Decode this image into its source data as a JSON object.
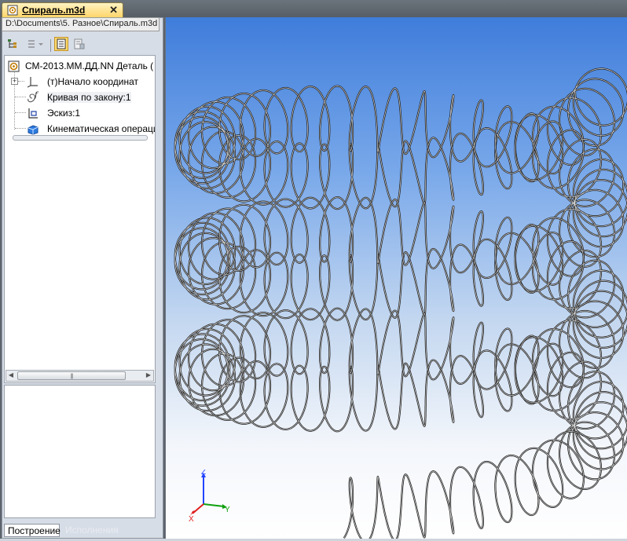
{
  "document_tab": {
    "title": "Спираль.m3d",
    "close_glyph": "✕",
    "icon": "part-document-icon"
  },
  "path_tooltip": "D:\\Documents\\5. Разное\\Спираль.m3d",
  "toolbar": {
    "buttons": [
      {
        "icon": "tree-structure-icon"
      },
      {
        "icon": "filter-dropdown-icon"
      },
      {
        "icon": "build-tree-icon",
        "active": true
      },
      {
        "icon": "properties-page-icon"
      }
    ]
  },
  "tree": {
    "items": [
      {
        "label": "СМ-2013.ММ.ДД.NN Деталь (",
        "icon": "part-icon"
      },
      {
        "label": "(т)Начало координат",
        "icon": "origin-icon",
        "expander": "+"
      },
      {
        "label": "Кривая по закону:1",
        "icon": "formula-curve-icon",
        "icon_glyph": "f"
      },
      {
        "label": "Эскиз:1",
        "icon": "sketch-icon"
      },
      {
        "label": "Кинематическая операци",
        "icon": "sweep-operation-icon"
      }
    ]
  },
  "bottom_tabs": {
    "construction": "Построение",
    "versions": "Исполнения"
  },
  "triad": {
    "z": "Z",
    "y": "Y",
    "x": "X",
    "colors": {
      "z": "#2244ff",
      "y": "#10a010",
      "x": "#e02020"
    }
  },
  "viewport": {
    "background_top": "#3f7ddb",
    "background_bottom": "#ffffff",
    "spring_color": "#1e1e1e"
  }
}
